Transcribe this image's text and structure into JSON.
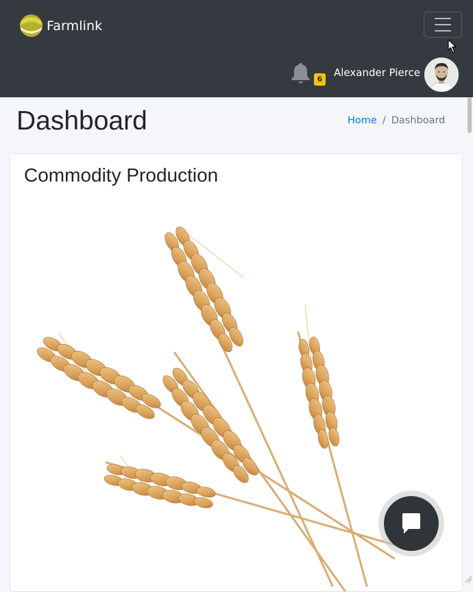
{
  "navbar": {
    "brand_name": "Farmlink",
    "brand_logo_icon": "farmlink-logo-icon",
    "menu_toggle_icon": "hamburger-menu-icon",
    "notifications": {
      "icon": "bell-icon",
      "count": "6",
      "badge_color": "#ffc107"
    },
    "user": {
      "name": "Alexander Pierce",
      "avatar_icon": "user-avatar"
    },
    "background_color": "#343a40"
  },
  "header": {
    "title": "Dashboard",
    "breadcrumb": {
      "home": "Home",
      "separator": "/",
      "current": "Dashboard"
    },
    "link_color": "#007bff"
  },
  "card": {
    "title": "Commodity Production",
    "image": "wheat-image"
  },
  "chat": {
    "icon": "chat-bubble-icon"
  }
}
